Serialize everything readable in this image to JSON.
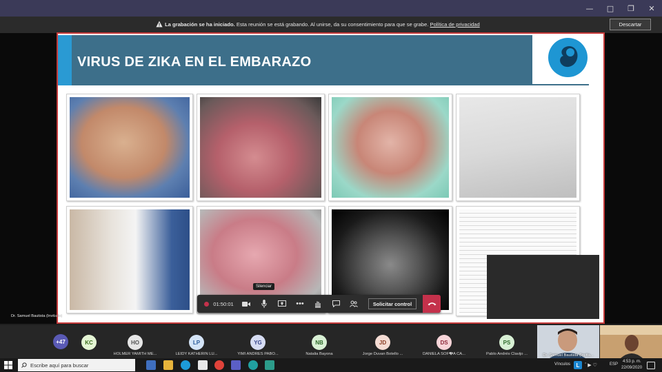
{
  "banner": {
    "bold": "La grabación se ha iniciado.",
    "text": " Esta reunión se está grabando. Al unirse, da su consentimiento para que se grabe. ",
    "link": "Política de privacidad",
    "dismiss": "Descartar"
  },
  "slide": {
    "title": "VIRUS DE ZIKA EN EL  EMBARAZO"
  },
  "presenter_tag": {
    "name": "Dr. Samuel Bautista (Invit",
    "suffix": "ado)"
  },
  "controls": {
    "timer": "01:50:01",
    "tooltip": "Silenciar",
    "request_control": "Solicitar control"
  },
  "participants": {
    "overflow": "+47",
    "list": [
      {
        "initials": "KC",
        "name": "",
        "color": "#e4f5d4",
        "text_color": "#3c6e1e"
      },
      {
        "initials": "HO",
        "name": "HOLMER YAMITH ME...",
        "color": "#e6e6e6",
        "text_color": "#555555"
      },
      {
        "initials": "LP",
        "name": "LEIDY KATHERIN LU...",
        "color": "#d4e4f7",
        "text_color": "#2b5b9a"
      },
      {
        "initials": "YG",
        "name": "YIMI ANDRES PABO...",
        "color": "#d6dcf2",
        "text_color": "#39468c"
      },
      {
        "initials": "NB",
        "name": "Natalia Bayona",
        "color": "#d8f0d4",
        "text_color": "#2e6b2a"
      },
      {
        "initials": "JD",
        "name": "Jorge Duvan Botello ...",
        "color": "#f5dcd4",
        "text_color": "#8a3b22"
      },
      {
        "initials": "DS",
        "name": "DANIELA SOF�A CA...",
        "color": "#f7d4d8",
        "text_color": "#8e2a3b"
      },
      {
        "initials": "PS",
        "name": "Pablo Andrés Clavijo ...",
        "color": "#d8f0d4",
        "text_color": "#2e6b2a"
      }
    ],
    "video_name": "Dr. Samuel Bautista (Invita..."
  },
  "taskbar": {
    "search_placeholder": "Escribe aquí para buscar",
    "links_label": "Vínculos",
    "lang": "ESP",
    "time": "4:53 p. m.",
    "date": "22/09/2020"
  },
  "colors": {
    "record": "#c4314b",
    "header": "#3d6f8a",
    "accent": "#2a9ad3"
  }
}
